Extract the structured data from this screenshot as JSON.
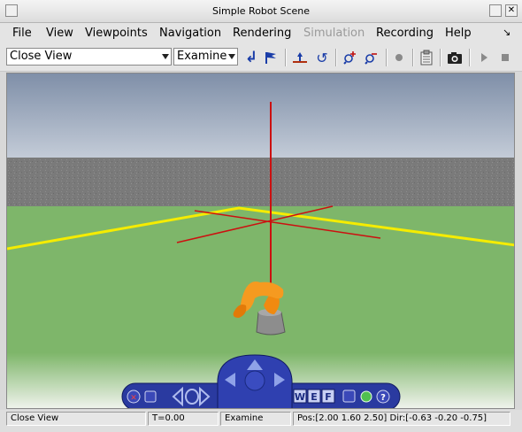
{
  "window": {
    "title": "Simple Robot Scene"
  },
  "menu": {
    "file": "File",
    "view": "View",
    "viewpoints": "Viewpoints",
    "navigation": "Navigation",
    "rendering": "Rendering",
    "simulation": "Simulation",
    "recording": "Recording",
    "help": "Help"
  },
  "toolbar": {
    "viewpoint_value": "Close View",
    "mode_value": "Examine"
  },
  "navigator": {
    "w_label": "W",
    "e_label": "E",
    "f_label": "F",
    "help_label": "?"
  },
  "status": {
    "viewpoint": "Close View",
    "time": "T=0.00",
    "mode": "Examine",
    "position": "Pos:[2.00 1.60 2.50] Dir:[-0.63 -0.20 -0.75]"
  },
  "colors": {
    "sky_top": "#7f8fa8",
    "sky_bottom": "#c4ccd8",
    "wall": "#7a7a7a",
    "ground": "#7eb66a",
    "boundary": "#f5ec00",
    "axes": "#cc1010",
    "robot": "#f08a10",
    "nav_blue": "#2a3aa0"
  }
}
